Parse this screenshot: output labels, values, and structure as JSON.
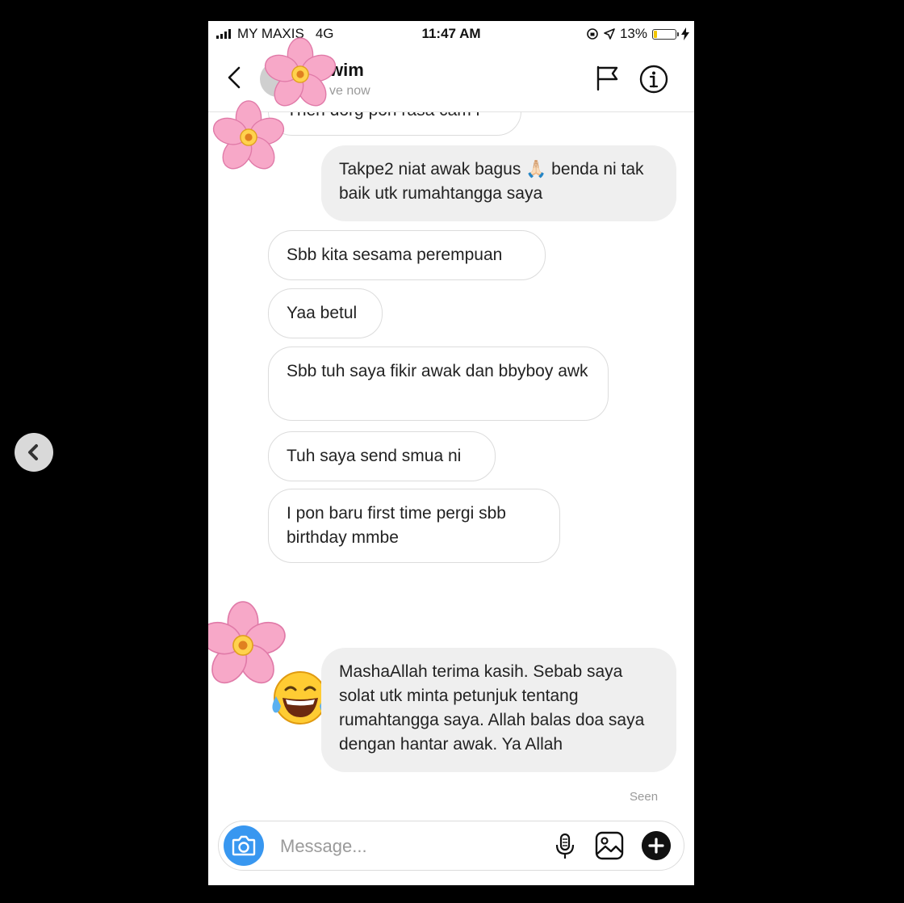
{
  "status_bar": {
    "carrier": "MY MAXIS",
    "network": "4G",
    "time": "11:47 AM",
    "battery": "13%"
  },
  "header": {
    "contact_name": "wim",
    "activity": "ve now"
  },
  "messages": [
    {
      "from": "them",
      "text": "Then dorg pon rasa cam i"
    },
    {
      "from": "me",
      "text": "Takpe2 niat awak bagus 🙏🏻 benda ni tak baik utk rumahtangga saya"
    },
    {
      "from": "them",
      "text": "Sbb kita sesama perempuan"
    },
    {
      "from": "them",
      "text": "Yaa betul"
    },
    {
      "from": "them",
      "text": "Sbb tuh saya fikir awak dan bbyboy awk"
    },
    {
      "from": "them",
      "text": "Tuh saya send smua ni"
    },
    {
      "from": "them",
      "text": "I pon baru first time pergi sbb birthday mmbe"
    },
    {
      "from": "them",
      "emoji": "laughing-with-tears"
    },
    {
      "from": "me",
      "text": "MashaAllah terima kasih. Sebab saya solat utk minta petunjuk tentang rumahtangga saya. Allah balas doa saya dengan hantar awak. Ya Allah"
    }
  ],
  "seen_label": "Seen",
  "composer": {
    "placeholder": "Message..."
  },
  "colors": {
    "accent": "#3897f0",
    "incoming_border": "#dcdcdc",
    "outgoing_bg": "#efefef",
    "flower": "#f7a8c8"
  },
  "icons": [
    "back-chevron-icon",
    "flag-icon",
    "info-icon",
    "camera-icon",
    "microphone-icon",
    "gallery-icon",
    "plus-icon",
    "flower-sticker",
    "prev-arrow-icon"
  ]
}
